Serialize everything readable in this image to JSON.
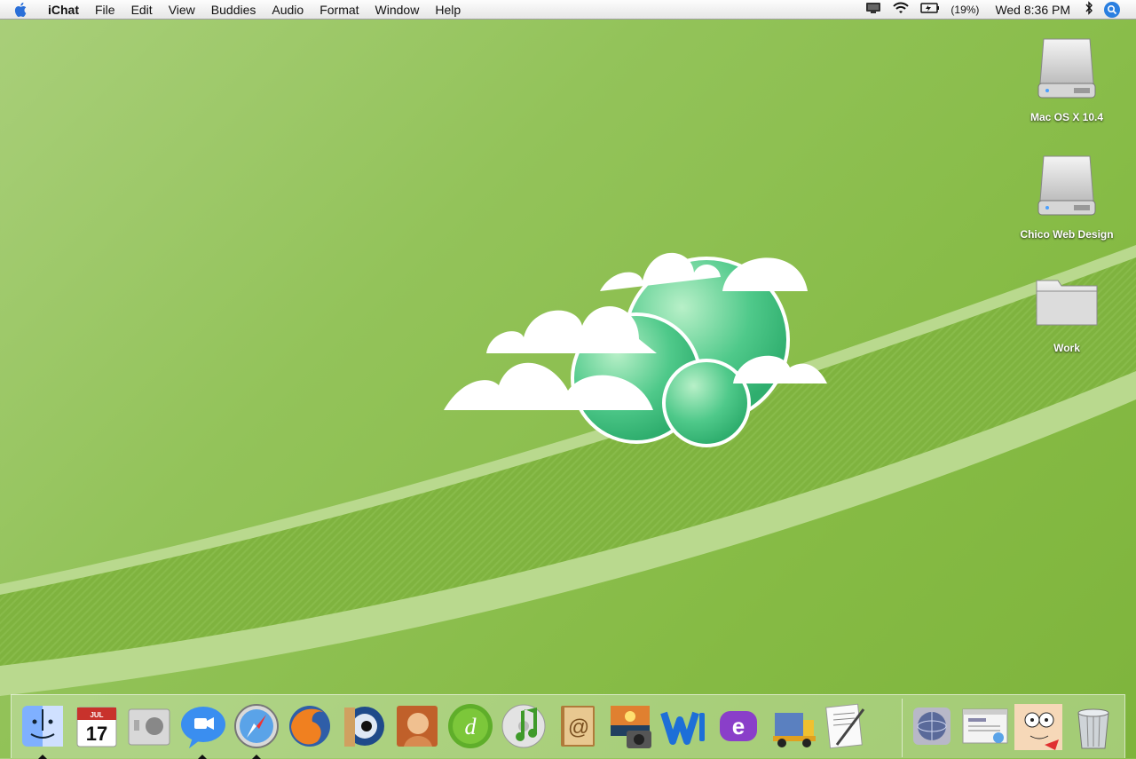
{
  "menubar": {
    "apple_icon": "apple-logo-icon",
    "app_name": "iChat",
    "menus": [
      "File",
      "Edit",
      "View",
      "Buddies",
      "Audio",
      "Format",
      "Window",
      "Help"
    ],
    "status": {
      "icons": [
        "display-icon",
        "wifi-icon",
        "battery-icon",
        "bluetooth-icon",
        "spotlight-icon"
      ],
      "battery_percent": "(19%)",
      "clock": "Wed 8:36 PM"
    }
  },
  "desktop": {
    "icons": [
      {
        "label": "Mac OS X 10.4",
        "icon": "hard-drive-icon"
      },
      {
        "label": "Chico Web Design",
        "icon": "hard-drive-icon"
      },
      {
        "label": "Work",
        "icon": "folder-icon"
      }
    ]
  },
  "dock": {
    "apps": [
      {
        "icon": "finder-icon",
        "running": true
      },
      {
        "icon": "ical-icon",
        "running": false,
        "text_month": "JUL",
        "text_day": "17"
      },
      {
        "icon": "system-preferences-icon",
        "running": false
      },
      {
        "icon": "ichat-icon",
        "running": true
      },
      {
        "icon": "safari-icon",
        "running": true
      },
      {
        "icon": "firefox-icon",
        "running": false
      },
      {
        "icon": "camino-icon",
        "running": false
      },
      {
        "icon": "photoshop-icon",
        "running": false
      },
      {
        "icon": "dreamweaver-icon",
        "running": false
      },
      {
        "icon": "itunes-icon",
        "running": false
      },
      {
        "icon": "address-book-icon",
        "running": false
      },
      {
        "icon": "iphoto-icon",
        "running": false
      },
      {
        "icon": "word-icon",
        "running": false
      },
      {
        "icon": "entourage-icon",
        "running": false
      },
      {
        "icon": "transmit-icon",
        "running": false
      },
      {
        "icon": "textedit-icon",
        "running": false
      }
    ],
    "documents": [
      {
        "icon": "network-icon"
      },
      {
        "icon": "web-document-icon"
      },
      {
        "icon": "cartoon-face-icon"
      },
      {
        "icon": "trash-icon"
      }
    ]
  },
  "colors": {
    "wallpaper_base": "#8cbf4e",
    "stripe_light": "#b9d98e",
    "menubar_bg": "#f0f0f0"
  }
}
